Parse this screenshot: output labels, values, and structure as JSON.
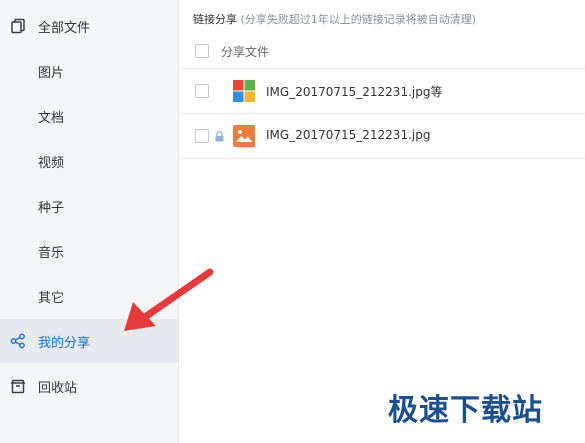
{
  "sidebar": {
    "items": [
      {
        "label": "全部文件",
        "icon": "file-copy-icon"
      },
      {
        "label": "图片"
      },
      {
        "label": "文档"
      },
      {
        "label": "视频"
      },
      {
        "label": "种子"
      },
      {
        "label": "音乐"
      },
      {
        "label": "其它"
      },
      {
        "label": "我的分享",
        "icon": "share-icon",
        "active": true
      },
      {
        "label": "回收站",
        "icon": "trash-icon"
      }
    ]
  },
  "main": {
    "title": "链接分享",
    "subtitle": "(分享失败超过1年以上的链接记录将被自动清理)",
    "column_header": "分享文件",
    "rows": [
      {
        "name": "IMG_20170715_212231.jpg等",
        "icon": "multi-file-icon",
        "locked": false
      },
      {
        "name": "IMG_20170715_212231.jpg",
        "icon": "image-file-icon",
        "locked": true
      }
    ]
  },
  "watermark": "极速下载站",
  "colors": {
    "accent": "#1a6fd8",
    "arrow": "#e8393b",
    "sidebar_bg": "#f4f6f8",
    "image_icon": "#f07c3c"
  }
}
